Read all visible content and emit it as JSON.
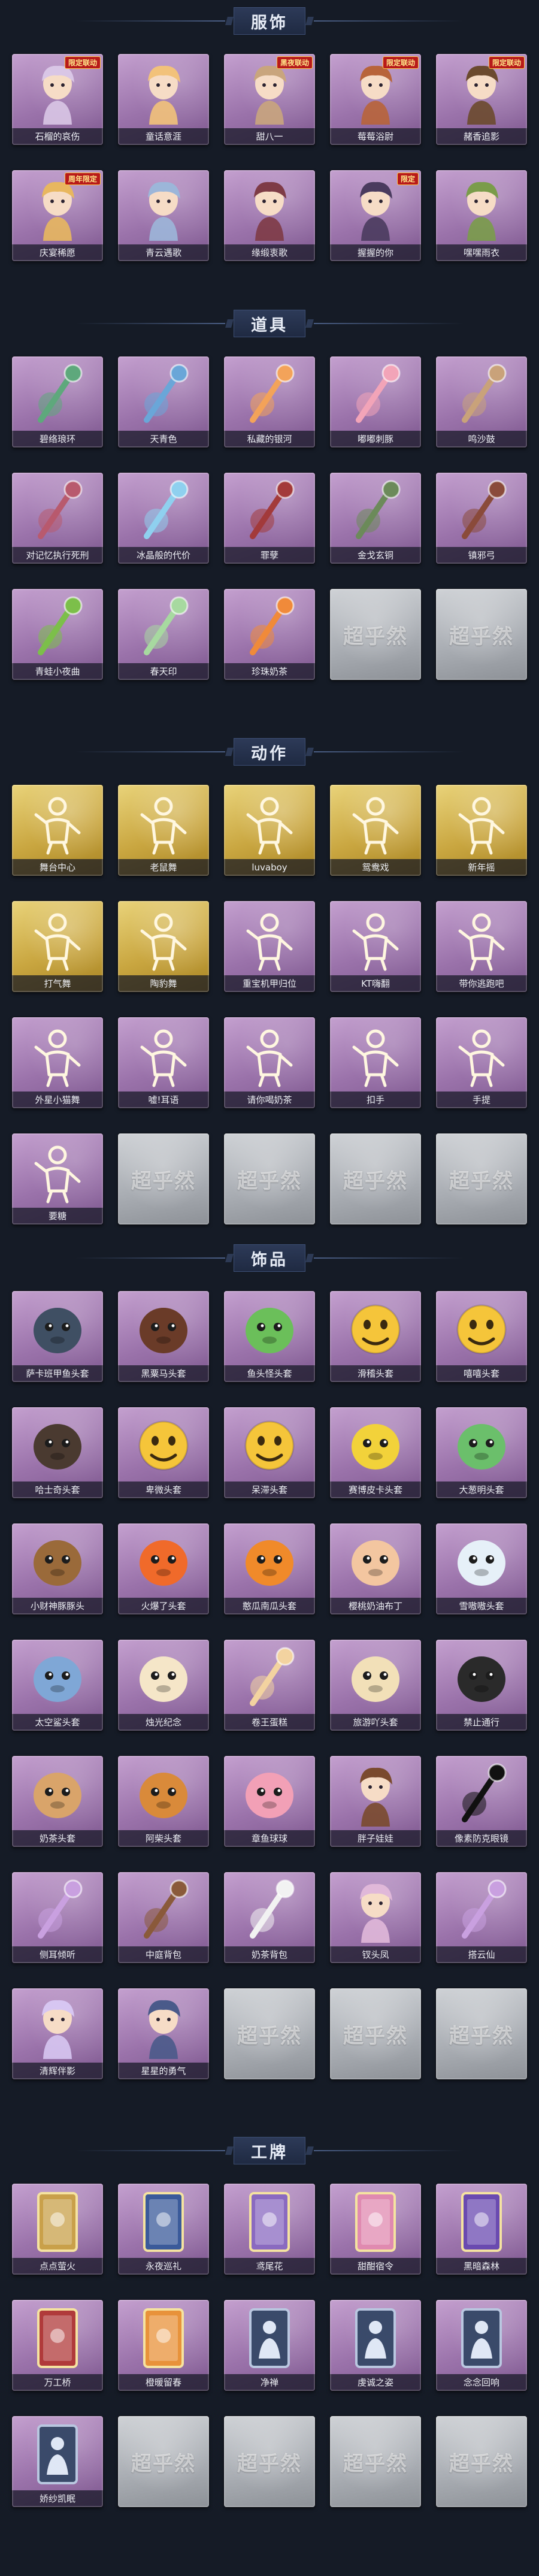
{
  "placeholder_mark": "超乎然",
  "sections": [
    {
      "title": "服饰",
      "items": [
        {
          "label": "石榴的哀伤",
          "icon": "doll-costume-icon",
          "style": "purple",
          "badge": "限定联动",
          "color": "#d9c6e6"
        },
        {
          "label": "童话意涯",
          "icon": "girl-costume-icon",
          "style": "purple",
          "badge": "",
          "color": "#f2c27a"
        },
        {
          "label": "甜八一",
          "icon": "boy-costume-icon",
          "style": "purple",
          "badge": "黑夜联动",
          "color": "#c9a57d"
        },
        {
          "label": "莓莓浴尉",
          "icon": "sailor-costume-icon",
          "style": "purple",
          "badge": "限定联动",
          "color": "#b8643a"
        },
        {
          "label": "赭香追影",
          "icon": "hunter-costume-icon",
          "style": "purple",
          "badge": "限定联动",
          "color": "#6b4a2e"
        },
        {
          "label": "庆宴稀愿",
          "icon": "party-costume-icon",
          "style": "purple",
          "badge": "周年限定",
          "color": "#e8b75f"
        },
        {
          "label": "青云遇歌",
          "icon": "cloud-costume-icon",
          "style": "purple",
          "badge": "",
          "color": "#9cb6d9"
        },
        {
          "label": "缘缎衷歌",
          "icon": "maiden-costume-icon",
          "style": "purple",
          "badge": "",
          "color": "#7e3b46"
        },
        {
          "label": "握握的你",
          "icon": "witch-costume-icon",
          "style": "purple",
          "badge": "限定",
          "color": "#4a3b5e"
        },
        {
          "label": "嘿嘿雨衣",
          "icon": "raincoat-costume-icon",
          "style": "purple",
          "badge": "",
          "color": "#7a9c4a"
        }
      ]
    },
    {
      "title": "道具",
      "items": [
        {
          "label": "碧络琅环",
          "icon": "jade-staff-icon",
          "style": "purple",
          "color": "#5ea87c"
        },
        {
          "label": "天青色",
          "icon": "blue-scepter-icon",
          "style": "purple",
          "color": "#6aa6d8"
        },
        {
          "label": "私藏的银河",
          "icon": "lotus-icon",
          "style": "purple",
          "color": "#f3a35a"
        },
        {
          "label": "嘟嘟刺豚",
          "icon": "pufferfish-icon",
          "style": "purple",
          "color": "#f2a4b8"
        },
        {
          "label": "鸣沙鼓",
          "icon": "hourglass-icon",
          "style": "purple",
          "color": "#c9a27a"
        },
        {
          "label": "对记忆执行死刑",
          "icon": "pistol-icon",
          "style": "purple",
          "color": "#b85a6e"
        },
        {
          "label": "冰晶般的代价",
          "icon": "ice-flower-icon",
          "style": "purple",
          "color": "#8fd0ef"
        },
        {
          "label": "罪孽",
          "icon": "red-sword-icon",
          "style": "purple",
          "color": "#a33a3a"
        },
        {
          "label": "金戈玄铜",
          "icon": "grenade-icon",
          "style": "purple",
          "color": "#6c8a5a"
        },
        {
          "label": "镇邪弓",
          "icon": "bow-icon",
          "style": "purple",
          "color": "#8a4b3a"
        },
        {
          "label": "青蛙小夜曲",
          "icon": "frog-icon",
          "style": "purple",
          "color": "#7cbf4a"
        },
        {
          "label": "春天印",
          "icon": "perfume-icon",
          "style": "purple",
          "color": "#a7d9a0"
        },
        {
          "label": "珍珠奶茶",
          "icon": "milk-tea-icon",
          "style": "purple",
          "color": "#f08a3a"
        },
        {
          "label": "",
          "icon": "empty-slot-icon",
          "style": "grey",
          "color": ""
        },
        {
          "label": "",
          "icon": "empty-slot-icon",
          "style": "grey",
          "color": ""
        }
      ]
    },
    {
      "title": "动作",
      "items": [
        {
          "label": "舞台中心",
          "icon": "pose-icon",
          "style": "gold"
        },
        {
          "label": "老鼠舞",
          "icon": "pose-icon",
          "style": "gold"
        },
        {
          "label": "luvaboy",
          "icon": "pose-icon",
          "style": "gold"
        },
        {
          "label": "鸳鸯戏",
          "icon": "pose-icon",
          "style": "gold"
        },
        {
          "label": "新年摇",
          "icon": "pose-icon",
          "style": "gold"
        },
        {
          "label": "打气舞",
          "icon": "pose-icon",
          "style": "gold"
        },
        {
          "label": "陶豹舞",
          "icon": "pose-icon",
          "style": "gold"
        },
        {
          "label": "重宝机甲归位",
          "icon": "pose-icon",
          "style": "purple"
        },
        {
          "label": "KT嗨翻",
          "icon": "pose-icon",
          "style": "purple"
        },
        {
          "label": "带你逃跑吧",
          "icon": "pose-icon",
          "style": "purple"
        },
        {
          "label": "外星小猫舞",
          "icon": "pose-icon",
          "style": "purple"
        },
        {
          "label": "嘘!耳语",
          "icon": "pose-icon",
          "style": "purple"
        },
        {
          "label": "请你喝奶茶",
          "icon": "pose-icon",
          "style": "purple"
        },
        {
          "label": "扣手",
          "icon": "pose-icon",
          "style": "purple"
        },
        {
          "label": "手提",
          "icon": "pose-icon",
          "style": "purple"
        },
        {
          "label": "要糖",
          "icon": "pose-icon",
          "style": "purple"
        },
        {
          "label": "",
          "icon": "empty-slot-icon",
          "style": "grey"
        },
        {
          "label": "",
          "icon": "empty-slot-icon",
          "style": "grey"
        },
        {
          "label": "",
          "icon": "empty-slot-icon",
          "style": "grey"
        },
        {
          "label": "",
          "icon": "empty-slot-icon",
          "style": "grey"
        }
      ]
    },
    {
      "title": "饰品",
      "items": [
        {
          "label": "萨卡班甲鱼头套",
          "icon": "fish-head-icon",
          "style": "purple",
          "color": "#3f4f63"
        },
        {
          "label": "黑粟马头套",
          "icon": "horse-head-icon",
          "style": "purple",
          "color": "#6a3b28"
        },
        {
          "label": "鱼头怪头套",
          "icon": "fishman-head-icon",
          "style": "purple",
          "color": "#6bbf5a"
        },
        {
          "label": "滑稽头套",
          "icon": "grin-face-icon",
          "style": "purple",
          "color": "#f5c53a"
        },
        {
          "label": "嘻嘻头套",
          "icon": "grin-face-icon",
          "style": "purple",
          "color": "#f5c53a"
        },
        {
          "label": "哈士奇头套",
          "icon": "husky-head-icon",
          "style": "purple",
          "color": "#4a3a30"
        },
        {
          "label": "卑微头套",
          "icon": "sad-face-icon",
          "style": "purple",
          "color": "#f5c53a"
        },
        {
          "label": "呆滞头套",
          "icon": "stare-face-icon",
          "style": "purple",
          "color": "#f5c53a"
        },
        {
          "label": "赛博皮卡头套",
          "icon": "pikachu-head-icon",
          "style": "purple",
          "color": "#f2d23a"
        },
        {
          "label": "大葱明头套",
          "icon": "scallion-head-icon",
          "style": "purple",
          "color": "#6bbf6b"
        },
        {
          "label": "小财神豚豚头",
          "icon": "capybara-head-icon",
          "style": "purple",
          "color": "#9a6a3a"
        },
        {
          "label": "火爆了头套",
          "icon": "fire-head-icon",
          "style": "purple",
          "color": "#f06a2a"
        },
        {
          "label": "憨瓜南瓜头套",
          "icon": "pumpkin-head-icon",
          "style": "purple",
          "color": "#f08a2a"
        },
        {
          "label": "樱桃奶油布丁",
          "icon": "pudding-head-icon",
          "style": "purple",
          "color": "#f3c6a0"
        },
        {
          "label": "雪嗷嗷头套",
          "icon": "snowman-head-icon",
          "style": "purple",
          "color": "#e6f0f8"
        },
        {
          "label": "太空鲨头套",
          "icon": "shark-head-icon",
          "style": "purple",
          "color": "#7fa7d6"
        },
        {
          "label": "烛光纪念",
          "icon": "candle-head-icon",
          "style": "purple",
          "color": "#f5e6c8"
        },
        {
          "label": "卷王蛋糕",
          "icon": "roll-cake-icon",
          "style": "purple",
          "color": "#f3d3a0"
        },
        {
          "label": "旅游吖头套",
          "icon": "bun-head-icon",
          "style": "purple",
          "color": "#f2e0b8"
        },
        {
          "label": "禁止通行",
          "icon": "barrier-head-icon",
          "style": "purple",
          "color": "#2a2a2a"
        },
        {
          "label": "奶茶头套",
          "icon": "milk-tea-head-icon",
          "style": "purple",
          "color": "#d9a46a"
        },
        {
          "label": "阿柴头套",
          "icon": "shiba-head-icon",
          "style": "purple",
          "color": "#d98a3a"
        },
        {
          "label": "章鱼球球",
          "icon": "octopus-head-icon",
          "style": "purple",
          "color": "#f2a0b6"
        },
        {
          "label": "胖子娃娃",
          "icon": "doll-head-icon",
          "style": "purple",
          "color": "#7a4a2e"
        },
        {
          "label": "像素防克眼镜",
          "icon": "pixel-glasses-icon",
          "style": "purple",
          "color": "#111111"
        },
        {
          "label": "侧耳倾听",
          "icon": "earring-icon",
          "style": "purple",
          "color": "#c9a0e0"
        },
        {
          "label": "中庭背包",
          "icon": "cake-backpack-icon",
          "style": "purple",
          "color": "#8a5a3a"
        },
        {
          "label": "奶茶背包",
          "icon": "qr-backpack-icon",
          "style": "purple",
          "color": "#f2f2f2"
        },
        {
          "label": "钗头凤",
          "icon": "hairpin-doll-icon",
          "style": "purple",
          "color": "#e0b8d9"
        },
        {
          "label": "搭云仙",
          "icon": "pendant-icon",
          "style": "purple",
          "color": "#c9a0e0"
        },
        {
          "label": "清辉伴影",
          "icon": "rabbit-doll-icon",
          "style": "purple",
          "color": "#d7c6f2"
        },
        {
          "label": "星星的勇气",
          "icon": "star-doll-icon",
          "style": "purple",
          "color": "#4a5a8a"
        },
        {
          "label": "",
          "icon": "empty-slot-icon",
          "style": "grey"
        },
        {
          "label": "",
          "icon": "empty-slot-icon",
          "style": "grey"
        },
        {
          "label": "",
          "icon": "empty-slot-icon",
          "style": "grey"
        }
      ]
    },
    {
      "title": "工牌",
      "items": [
        {
          "label": "点点萤火",
          "icon": "card-frame-icon",
          "style": "purple",
          "color": "#c9a04a"
        },
        {
          "label": "永夜巡礼",
          "icon": "card-frame-icon",
          "style": "purple",
          "color": "#3a5a9a"
        },
        {
          "label": "鸢尾花",
          "icon": "card-frame-icon",
          "style": "purple",
          "color": "#8a6ac0"
        },
        {
          "label": "甜酣宿令",
          "icon": "card-frame-icon",
          "style": "purple",
          "color": "#e08ab0"
        },
        {
          "label": "黑暗森林",
          "icon": "card-frame-icon",
          "style": "purple",
          "color": "#6a4ab0"
        },
        {
          "label": "万工桥",
          "icon": "card-frame-icon",
          "style": "purple",
          "color": "#b03a3a"
        },
        {
          "label": "橙暖留春",
          "icon": "card-frame-icon",
          "style": "purple",
          "color": "#e8923a"
        },
        {
          "label": "净禅",
          "icon": "silhouette-card-icon",
          "style": "purple",
          "color": "#3a4a6a"
        },
        {
          "label": "虔诚之姿",
          "icon": "silhouette-card-icon",
          "style": "purple",
          "color": "#3a4a6a"
        },
        {
          "label": "念念回响",
          "icon": "silhouette-card-icon",
          "style": "purple",
          "color": "#3a4a6a"
        },
        {
          "label": "娇纱凯眠",
          "icon": "silhouette-card-icon",
          "style": "purple",
          "color": "#3a4a6a"
        },
        {
          "label": "",
          "icon": "empty-slot-icon",
          "style": "grey"
        },
        {
          "label": "",
          "icon": "empty-slot-icon",
          "style": "grey"
        },
        {
          "label": "",
          "icon": "empty-slot-icon",
          "style": "grey"
        },
        {
          "label": "",
          "icon": "empty-slot-icon",
          "style": "grey"
        }
      ]
    }
  ]
}
